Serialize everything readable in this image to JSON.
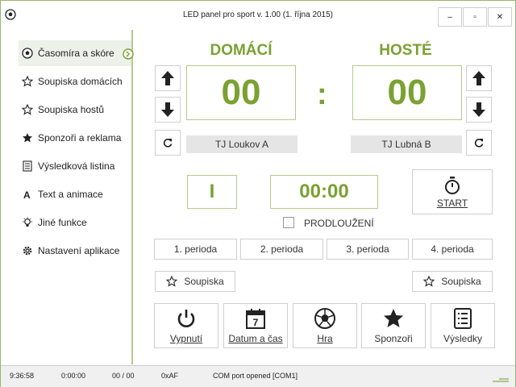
{
  "title": "LED panel pro sport v. 1.00 (1. října 2015)",
  "window_buttons": {
    "minimize": "–",
    "maximize": "▫",
    "close": "✕"
  },
  "sidebar": {
    "items": [
      {
        "label": "Časomíra a skóre",
        "icon": "soccer-ball-icon"
      },
      {
        "label": "Soupiska domácích",
        "icon": "star-outline-icon"
      },
      {
        "label": "Soupiska hostů",
        "icon": "star-outline-icon"
      },
      {
        "label": "Sponzoři a reklama",
        "icon": "star-filled-icon"
      },
      {
        "label": "Výsledková listina",
        "icon": "list-icon"
      },
      {
        "label": "Text a animace",
        "icon": "text-icon"
      },
      {
        "label": "Jiné funkce",
        "icon": "bulb-icon"
      },
      {
        "label": "Nastavení aplikace",
        "icon": "gear-icon"
      }
    ]
  },
  "home": {
    "title": "DOMÁCÍ",
    "score": "00",
    "name": "TJ Loukov  A"
  },
  "away": {
    "title": "HOSTÉ",
    "score": "00",
    "name": "TJ Lubná  B"
  },
  "colon": ":",
  "period": "I",
  "time": "00:00",
  "start_label": "START",
  "overtime_label": "PRODLOUŽENÍ",
  "periods": [
    "1. perioda",
    "2. perioda",
    "3. perioda",
    "4. perioda"
  ],
  "roster_label": "Soupiska",
  "bottom_buttons": [
    {
      "label": "Vypnutí",
      "icon": "power-icon"
    },
    {
      "label": "Datum a čas",
      "icon": "calendar-icon"
    },
    {
      "label": "Hra",
      "icon": "soccer-ball-icon"
    },
    {
      "label": "Sponzoři",
      "icon": "star-icon"
    },
    {
      "label": "Výsledky",
      "icon": "list-icon"
    }
  ],
  "calendar_day": "7",
  "status": {
    "clock": "9:36:58",
    "timer": "0:00:00",
    "count": "00 / 00",
    "hex": "0xAF",
    "message": "COM port opened [COM1]"
  },
  "colors": {
    "accent": "#7aa131",
    "border": "#b6c98e"
  }
}
